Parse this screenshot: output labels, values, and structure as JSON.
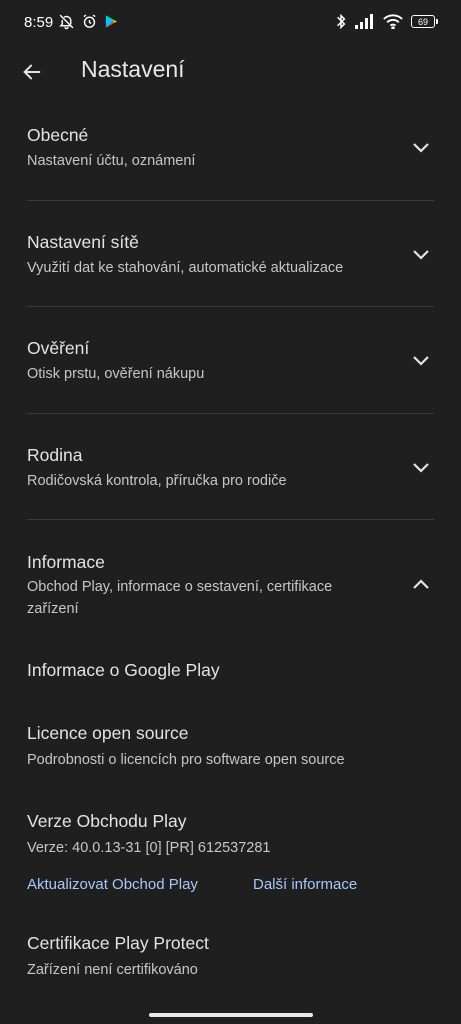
{
  "status_bar": {
    "time": "8:59",
    "battery": "69"
  },
  "header": {
    "title": "Nastavení"
  },
  "sections": [
    {
      "title": "Obecné",
      "subtitle": "Nastavení účtu, oznámení",
      "expanded": false
    },
    {
      "title": "Nastavení sítě",
      "subtitle": "Využití dat ke stahování, automatické aktualizace",
      "expanded": false
    },
    {
      "title": "Ověření",
      "subtitle": "Otisk prstu, ověření nákupu",
      "expanded": false
    },
    {
      "title": "Rodina",
      "subtitle": "Rodičovská kontrola, příručka pro rodiče",
      "expanded": false
    },
    {
      "title": "Informace",
      "subtitle": "Obchod Play, informace o sestavení, certifikace zařízení",
      "expanded": true
    }
  ],
  "info_items": {
    "about": {
      "title": "Informace o Google Play"
    },
    "licenses": {
      "title": "Licence open source",
      "subtitle": "Podrobnosti o licencích pro software open source"
    },
    "version": {
      "title": "Verze Obchodu Play",
      "subtitle": "Verze: 40.0.13-31 [0] [PR] 612537281",
      "update_link": "Aktualizovat Obchod Play",
      "more_link": "Další informace"
    },
    "protect": {
      "title": "Certifikace Play Protect",
      "subtitle": "Zařízení není certifikováno"
    }
  },
  "colors": {
    "background": "#1f1f1f",
    "link": "#a8c7fa",
    "text_primary": "#e3e3e3",
    "text_secondary": "#c4c7c5"
  }
}
